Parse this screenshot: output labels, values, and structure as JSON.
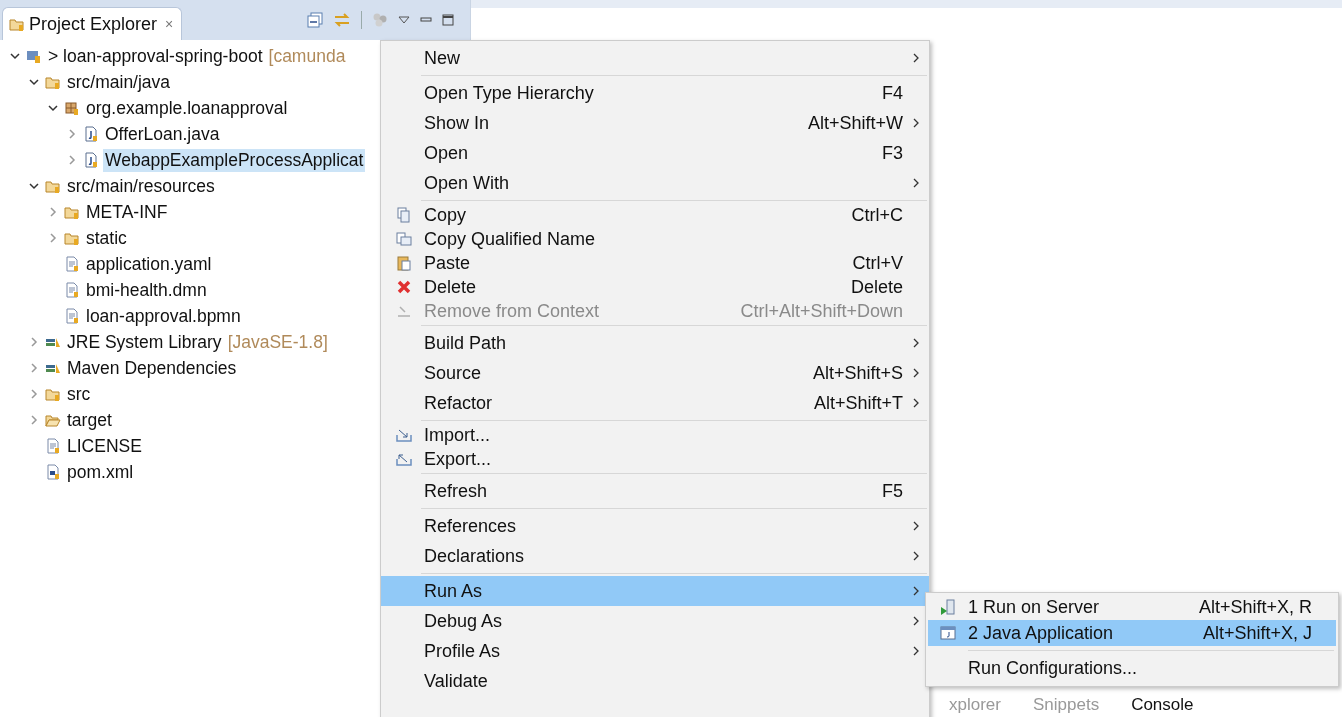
{
  "view": {
    "title": "Project Explorer",
    "close": "×"
  },
  "tree": [
    {
      "label": "> loan-approval-spring-boot",
      "decoration": "[camunda",
      "kind": "project",
      "expanded": true,
      "selected": false,
      "children": [
        {
          "label": "src/main/java",
          "kind": "source-folder",
          "expanded": true,
          "selected": false,
          "children": [
            {
              "label": "org.example.loanapproval",
              "kind": "package",
              "expanded": true,
              "selected": false,
              "children": [
                {
                  "label": "OfferLoan.java",
                  "kind": "java-file",
                  "expanded": false,
                  "selected": false
                },
                {
                  "label": "WebappExampleProcessApplicat",
                  "kind": "java-file",
                  "expanded": false,
                  "selected": true
                }
              ]
            }
          ]
        },
        {
          "label": "src/main/resources",
          "kind": "source-folder",
          "expanded": true,
          "selected": false,
          "children": [
            {
              "label": "META-INF",
              "kind": "folder",
              "expanded": false,
              "selected": false
            },
            {
              "label": "static",
              "kind": "folder",
              "expanded": false,
              "selected": false
            },
            {
              "label": "application.yaml",
              "kind": "file",
              "selected": false
            },
            {
              "label": "bmi-health.dmn",
              "kind": "file",
              "selected": false
            },
            {
              "label": "loan-approval.bpmn",
              "kind": "file",
              "selected": false
            }
          ]
        },
        {
          "label": "JRE System Library",
          "decoration": "[JavaSE-1.8]",
          "kind": "library",
          "expanded": false,
          "selected": false
        },
        {
          "label": "Maven Dependencies",
          "kind": "library",
          "expanded": false,
          "selected": false
        },
        {
          "label": "src",
          "kind": "folder",
          "expanded": false,
          "selected": false
        },
        {
          "label": "target",
          "kind": "open-folder",
          "expanded": false,
          "selected": false
        },
        {
          "label": "LICENSE",
          "kind": "file",
          "selected": false
        },
        {
          "label": "pom.xml",
          "kind": "xml-file",
          "selected": false
        }
      ]
    }
  ],
  "bottom_tabs": [
    {
      "label": "xplorer",
      "selected": false
    },
    {
      "label": "Snippets",
      "selected": false
    },
    {
      "label": "Console",
      "selected": true
    }
  ],
  "context_menu": {
    "groups": [
      [
        {
          "label": "New",
          "submenu": true,
          "disabled": false,
          "selected": false
        }
      ],
      [
        {
          "label": "Open Type Hierarchy",
          "shortcut": "F4",
          "submenu": false,
          "disabled": false,
          "selected": false
        },
        {
          "label": "Show In",
          "shortcut": "Alt+Shift+W",
          "submenu": true,
          "disabled": false,
          "selected": false
        },
        {
          "label": "Open",
          "shortcut": "F3",
          "submenu": false,
          "disabled": false,
          "selected": false
        },
        {
          "label": "Open With",
          "submenu": true,
          "disabled": false,
          "selected": false
        }
      ],
      [
        {
          "label": "Copy",
          "shortcut": "Ctrl+C",
          "kind": "copy",
          "submenu": false,
          "disabled": false,
          "selected": false
        },
        {
          "label": "Copy Qualified Name",
          "kind": "copy-name",
          "submenu": false,
          "disabled": false,
          "selected": false
        },
        {
          "label": "Paste",
          "shortcut": "Ctrl+V",
          "kind": "paste",
          "submenu": false,
          "disabled": false,
          "selected": false
        },
        {
          "label": "Delete",
          "shortcut": "Delete",
          "kind": "delete",
          "submenu": false,
          "disabled": false,
          "selected": false
        },
        {
          "label": "Remove from Context",
          "shortcut": "Ctrl+Alt+Shift+Down",
          "kind": "remove",
          "submenu": false,
          "disabled": true,
          "selected": false
        }
      ],
      [
        {
          "label": "Build Path",
          "submenu": true,
          "disabled": false,
          "selected": false
        },
        {
          "label": "Source",
          "shortcut": "Alt+Shift+S",
          "submenu": true,
          "disabled": false,
          "selected": false
        },
        {
          "label": "Refactor",
          "shortcut": "Alt+Shift+T",
          "submenu": true,
          "disabled": false,
          "selected": false
        }
      ],
      [
        {
          "label": "Import...",
          "kind": "import",
          "submenu": false,
          "disabled": false,
          "selected": false
        },
        {
          "label": "Export...",
          "kind": "export",
          "submenu": false,
          "disabled": false,
          "selected": false
        }
      ],
      [
        {
          "label": "Refresh",
          "shortcut": "F5",
          "submenu": false,
          "disabled": false,
          "selected": false
        }
      ],
      [
        {
          "label": "References",
          "submenu": true,
          "disabled": false,
          "selected": false
        },
        {
          "label": "Declarations",
          "submenu": true,
          "disabled": false,
          "selected": false
        }
      ],
      [
        {
          "label": "Run As",
          "submenu": true,
          "disabled": false,
          "selected": true
        },
        {
          "label": "Debug As",
          "submenu": true,
          "disabled": false,
          "selected": false
        },
        {
          "label": "Profile As",
          "submenu": true,
          "disabled": false,
          "selected": false
        },
        {
          "label": "Validate",
          "submenu": false,
          "disabled": false,
          "selected": false
        }
      ]
    ]
  },
  "submenu": {
    "groups": [
      [
        {
          "label": "1 Run on Server",
          "shortcut": "Alt+Shift+X, R",
          "kind": "server",
          "selected": false
        },
        {
          "label": "2 Java Application",
          "shortcut": "Alt+Shift+X, J",
          "kind": "java-app",
          "selected": true
        }
      ],
      [
        {
          "label": "Run Configurations...",
          "selected": false
        }
      ]
    ]
  }
}
